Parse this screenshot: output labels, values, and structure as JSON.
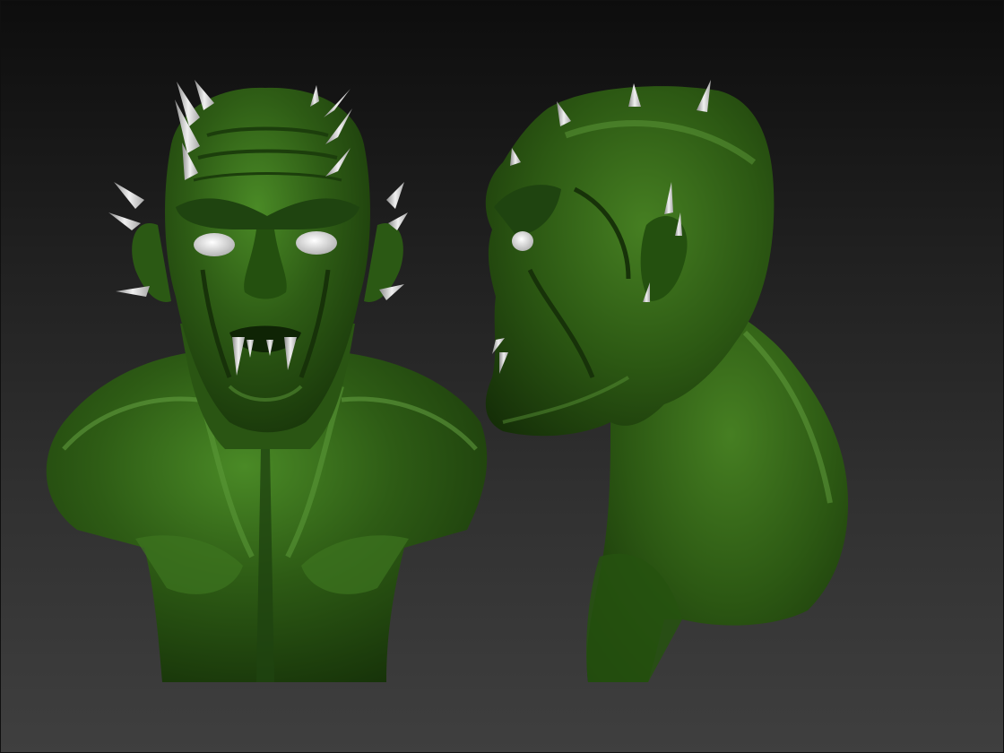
{
  "viewport": {
    "background_top": "#0d0d0d",
    "background_bottom": "#3f3f3f"
  },
  "models": [
    {
      "name": "creature-bust-front",
      "view": "front",
      "material_color": "#2e5c15",
      "highlight_color": "#5d9a3a",
      "shadow_color": "#173209",
      "spike_color": "#d4d4d4"
    },
    {
      "name": "creature-bust-side",
      "view": "side",
      "material_color": "#2e5c15",
      "highlight_color": "#5d9a3a",
      "shadow_color": "#173209",
      "spike_color": "#d4d4d4"
    }
  ]
}
